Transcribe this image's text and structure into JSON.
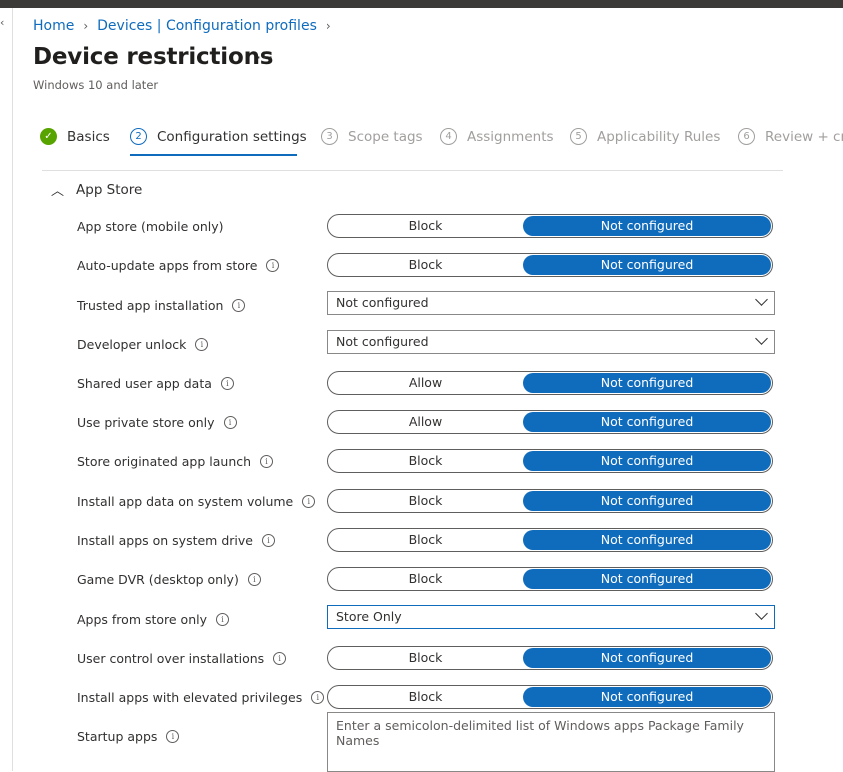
{
  "breadcrumb": {
    "items": [
      "Home",
      "Devices | Configuration profiles"
    ]
  },
  "page": {
    "title": "Device restrictions",
    "more": "···",
    "subtitle": "Windows 10 and later"
  },
  "wizard": {
    "steps": [
      {
        "num": "✓",
        "label": "Basics",
        "state": "done"
      },
      {
        "num": "2",
        "label": "Configuration settings",
        "state": "active"
      },
      {
        "num": "3",
        "label": "Scope tags",
        "state": "future"
      },
      {
        "num": "4",
        "label": "Assignments",
        "state": "future"
      },
      {
        "num": "5",
        "label": "Applicability Rules",
        "state": "future"
      },
      {
        "num": "6",
        "label": "Review + cre",
        "state": "future"
      }
    ]
  },
  "section": {
    "title": "App Store",
    "expanded": true
  },
  "settings": [
    {
      "label": "App store (mobile only)",
      "info": false,
      "type": "toggle",
      "left": "Block",
      "right": "Not configured",
      "selected": "Not configured"
    },
    {
      "label": "Auto-update apps from store",
      "info": true,
      "type": "toggle",
      "left": "Block",
      "right": "Not configured",
      "selected": "Not configured"
    },
    {
      "label": "Trusted app installation",
      "info": true,
      "type": "select",
      "value": "Not configured"
    },
    {
      "label": "Developer unlock",
      "info": true,
      "type": "select",
      "value": "Not configured"
    },
    {
      "label": "Shared user app data",
      "info": true,
      "type": "toggle",
      "left": "Allow",
      "right": "Not configured",
      "selected": "Not configured"
    },
    {
      "label": "Use private store only",
      "info": true,
      "type": "toggle",
      "left": "Allow",
      "right": "Not configured",
      "selected": "Not configured"
    },
    {
      "label": "Store originated app launch",
      "info": true,
      "type": "toggle",
      "left": "Block",
      "right": "Not configured",
      "selected": "Not configured"
    },
    {
      "label": "Install app data on system volume",
      "info": true,
      "type": "toggle",
      "left": "Block",
      "right": "Not configured",
      "selected": "Not configured"
    },
    {
      "label": "Install apps on system drive",
      "info": true,
      "type": "toggle",
      "left": "Block",
      "right": "Not configured",
      "selected": "Not configured"
    },
    {
      "label": "Game DVR (desktop only)",
      "info": true,
      "type": "toggle",
      "left": "Block",
      "right": "Not configured",
      "selected": "Not configured"
    },
    {
      "label": "Apps from store only",
      "info": true,
      "type": "select",
      "value": "Store Only",
      "focused": true
    },
    {
      "label": "User control over installations",
      "info": true,
      "type": "toggle",
      "left": "Block",
      "right": "Not configured",
      "selected": "Not configured"
    },
    {
      "label": "Install apps with elevated privileges",
      "info": true,
      "type": "toggle",
      "left": "Block",
      "right": "Not configured",
      "selected": "Not configured"
    },
    {
      "label": "Startup apps",
      "info": true,
      "type": "textarea",
      "placeholder": "Enter a semicolon-delimited list of Windows apps Package Family Names"
    }
  ],
  "colors": {
    "accent": "#0f6cbd",
    "success": "#57a300",
    "text": "#323130"
  }
}
